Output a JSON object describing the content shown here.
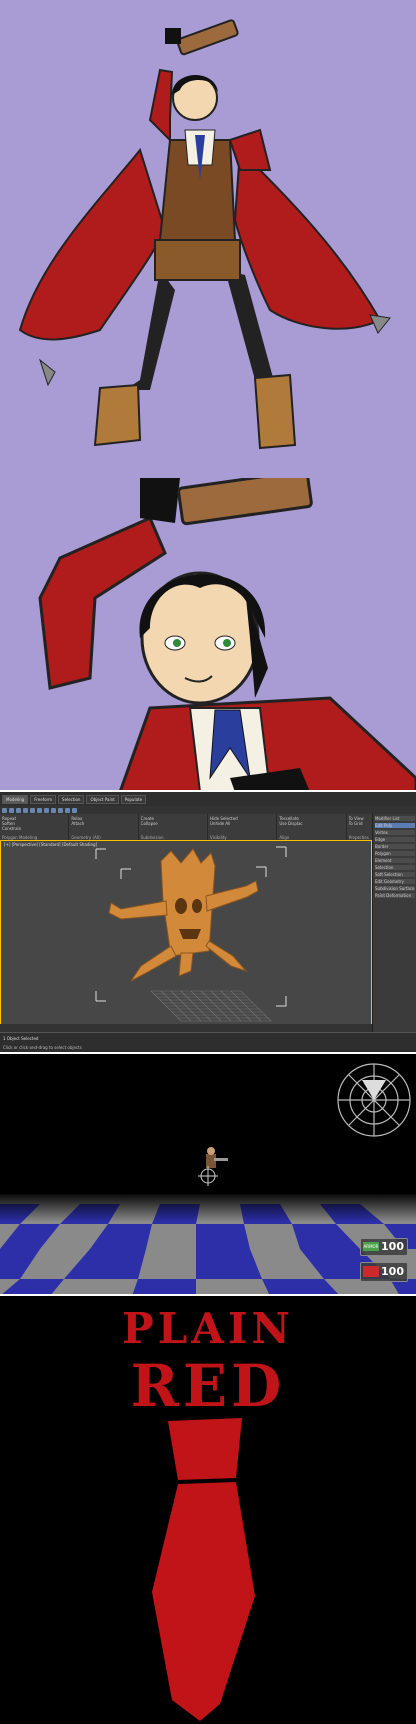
{
  "panels": {
    "modeling_app": {
      "tabs": [
        "Modeling",
        "Freeform",
        "Selection",
        "Object Paint",
        "Populate"
      ],
      "ribbon_groups": [
        {
          "items": [
            "Repeat",
            "Soften",
            "Constrain"
          ],
          "label": "Polygon Modeling"
        },
        {
          "items": [
            "Relax",
            "Attach"
          ],
          "label": "Geometry (All)"
        },
        {
          "items": [
            "Create",
            "Collapse"
          ],
          "label": "Subdivision"
        },
        {
          "items": [
            "Hide Selected",
            "Unhide All"
          ],
          "label": "Visibility"
        },
        {
          "items": [
            "Tessellate",
            "Use Displac"
          ],
          "label": "Align"
        },
        {
          "items": [
            "To View",
            "To Grid"
          ],
          "label": "Properties"
        }
      ],
      "viewport_label": "[+] [Perspective] [Standard] [Default Shading]",
      "command_panel_items": [
        "Modifier List",
        "Edit Poly",
        "Vertex",
        "Edge",
        "Border",
        "Polygon",
        "Element",
        "Selection",
        "Soft Selection",
        "Edit Geometry",
        "Subdivision Surface",
        "Paint Deformation"
      ],
      "status_line_1": "1 Object Selected",
      "status_line_2": "Click or click-and-drag to select objects"
    },
    "game_hud": {
      "armor_value": "100",
      "health_value": "100",
      "armor_label": "ARMOR",
      "colors": {
        "armor": "#4aa34a",
        "health": "#cc2a2a",
        "floor_blue": "#2c2fa8",
        "floor_gray": "#8a8a8a"
      }
    },
    "poster": {
      "title_line_1": "PLAIN",
      "title_line_2": "RED",
      "colors": {
        "accent": "#c01418"
      }
    }
  }
}
